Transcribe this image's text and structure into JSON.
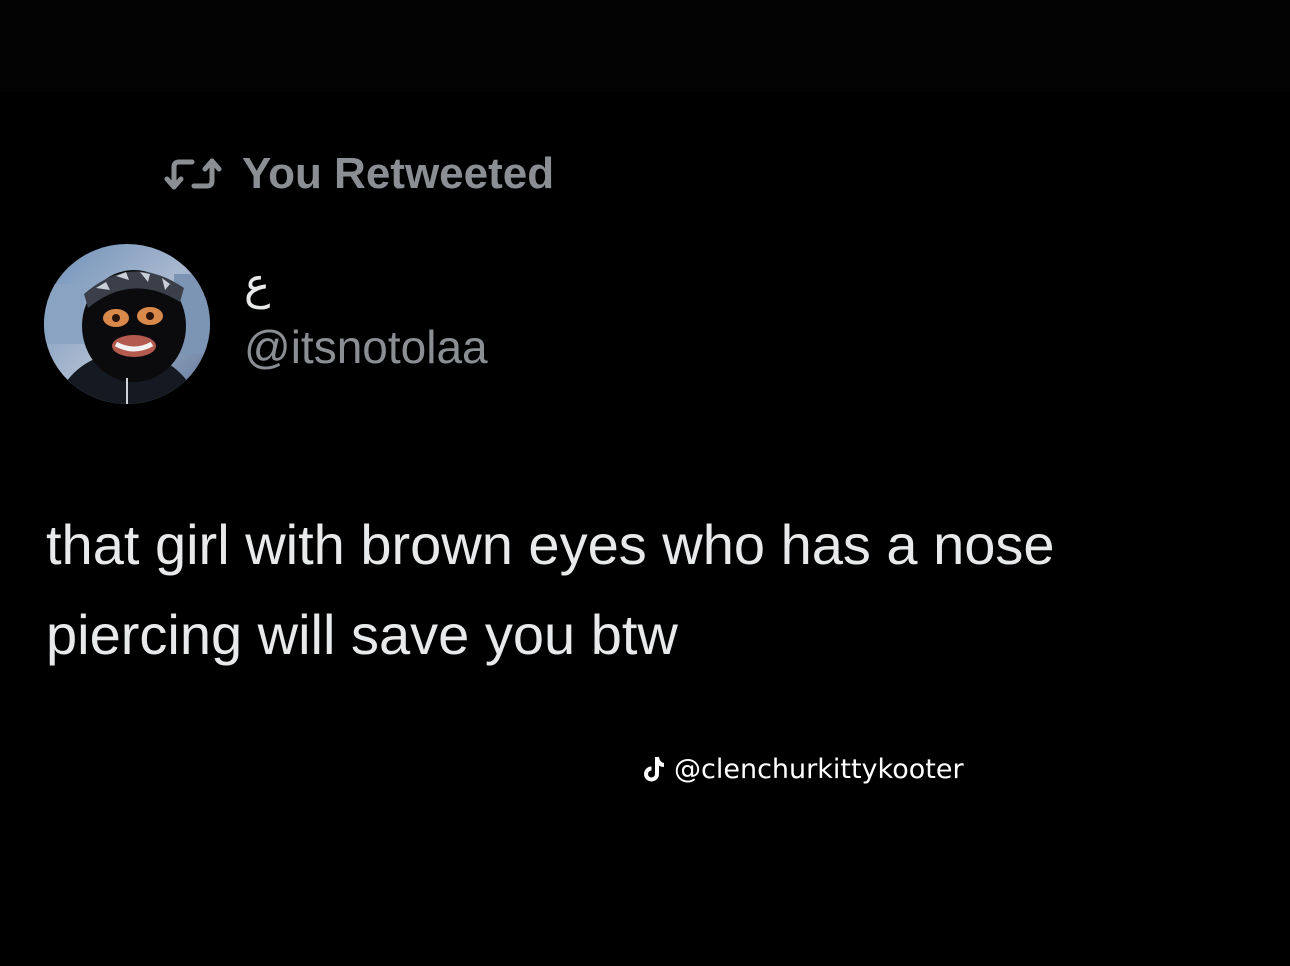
{
  "retweet": {
    "icon": "retweet-icon",
    "label": "You Retweeted"
  },
  "author": {
    "avatar_icon": "avatar-image",
    "display_name": "ع",
    "handle": "@itsnotolaa"
  },
  "tweet": {
    "text": "that girl with brown eyes who has a nose piercing will save you btw"
  },
  "watermark": {
    "icon": "tiktok-icon",
    "text": "@clenchurkittykooter"
  },
  "colors": {
    "background": "#000000",
    "primary_text": "#e7e9ea",
    "secondary_text": "#8b8f94",
    "watermark": "#ffffff"
  }
}
